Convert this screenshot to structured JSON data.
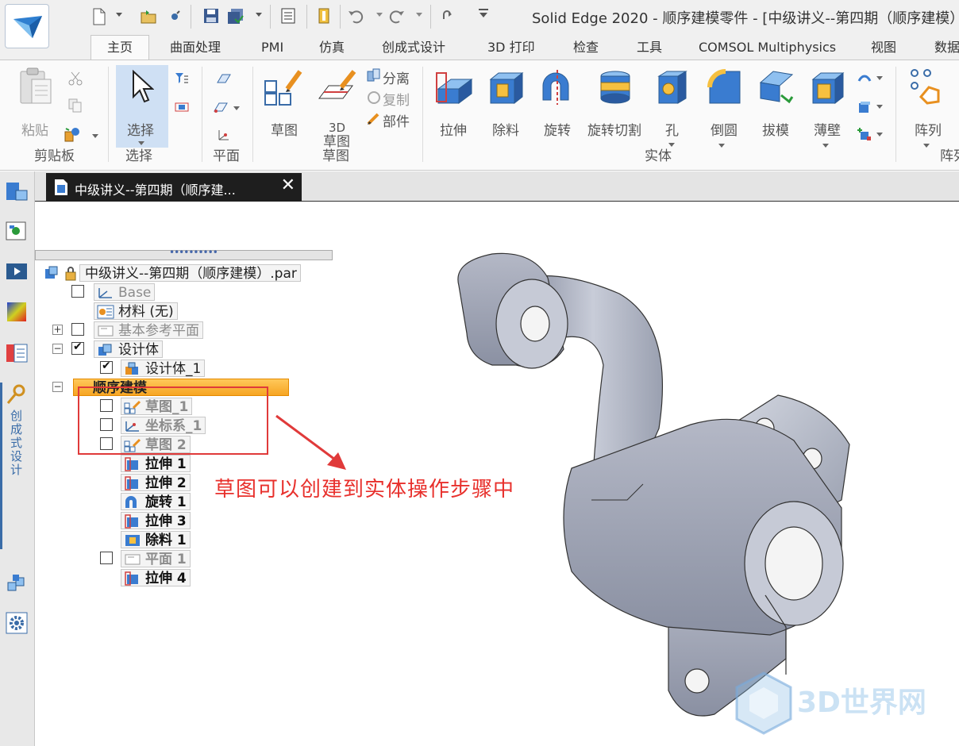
{
  "window": {
    "title": "Solid Edge 2020 - 顺序建模零件 - [中级讲义--第四期（顺序建模）"
  },
  "tabs": [
    {
      "label": "主页",
      "active": true
    },
    {
      "label": "曲面处理"
    },
    {
      "label": "PMI"
    },
    {
      "label": "仿真"
    },
    {
      "label": "创成式设计"
    },
    {
      "label": "3D 打印"
    },
    {
      "label": "检查"
    },
    {
      "label": "工具"
    },
    {
      "label": "COMSOL Multiphysics"
    },
    {
      "label": "视图"
    },
    {
      "label": "数据"
    }
  ],
  "ribbon": {
    "clipboard": {
      "paste": "粘贴",
      "group": "剪贴板"
    },
    "select": {
      "select": "选择",
      "group": "选择"
    },
    "plane": {
      "group": "平面"
    },
    "sketch": {
      "sketch": "草图",
      "sketch3d_a": "3D",
      "sketch3d_b": "草图",
      "sketch3d_c": "草图",
      "separate": "分离",
      "copy": "复制",
      "part": "部件"
    },
    "solid": {
      "extrude": "拉伸",
      "cutout": "除料",
      "revolve": "旋转",
      "revolve_cut": "旋转切割",
      "hole": "孔",
      "round": "倒圆",
      "draft": "拔模",
      "thin_wall": "薄壁",
      "group": "实体"
    },
    "pattern": {
      "pattern": "阵列",
      "group": "阵列"
    }
  },
  "left_toolbar": {
    "vertical_label": "创成式设计",
    "icons": [
      "part-view-icon",
      "feature-library-icon",
      "movie-icon",
      "color-map-icon",
      "results-icon",
      "generative-design-icon",
      "assembly-icon",
      "settings-gear-icon"
    ]
  },
  "document_tab": {
    "label": "中级讲义--第四期（顺序建...",
    "close": "✕"
  },
  "tree": {
    "root": "中级讲义--第四期（顺序建模）.par",
    "items": [
      {
        "label": "Base",
        "grey": true
      },
      {
        "label": "材料 (无)"
      },
      {
        "label": "基本参考平面",
        "grey": true
      },
      {
        "label": "设计体"
      },
      {
        "label": "设计体_1"
      },
      {
        "label": "顺序建模"
      },
      {
        "label": "草图_1",
        "grey": true
      },
      {
        "label": "坐标系_1",
        "grey": true
      },
      {
        "label": "草图 2",
        "grey": true
      },
      {
        "label": "拉伸 1"
      },
      {
        "label": "拉伸 2"
      },
      {
        "label": "旋转 1"
      },
      {
        "label": "拉伸 3"
      },
      {
        "label": "除料 1"
      },
      {
        "label": "平面 1",
        "grey": true
      },
      {
        "label": "拉伸 4"
      }
    ]
  },
  "annotation": {
    "text": "草图可以创建到实体操作步骤中",
    "color": "#e8302c"
  },
  "watermark": {
    "text": "3D世界网"
  },
  "colors": {
    "accent": "#3a6ca8",
    "selection": "#f6a523",
    "part_gray": "#9aa0b0"
  }
}
